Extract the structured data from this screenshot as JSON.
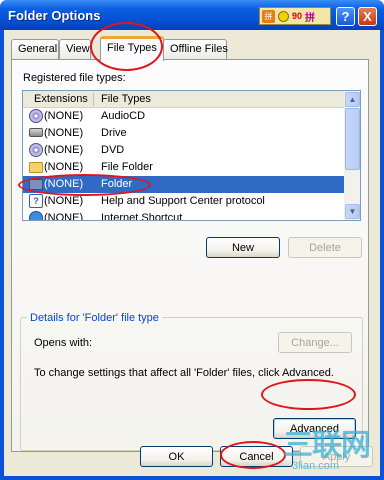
{
  "window": {
    "title": "Folder Options"
  },
  "ime_bar": {
    "logo": "拼",
    "mode": "90",
    "han": "拼"
  },
  "titlebar_buttons": {
    "help": "?",
    "close": "X"
  },
  "tabs": [
    {
      "label": "General"
    },
    {
      "label": "View"
    },
    {
      "label": "File Types",
      "active": true
    },
    {
      "label": "Offline Files"
    }
  ],
  "registered_label": "Registered file types:",
  "list": {
    "columns": [
      "Extensions",
      "File Types"
    ],
    "rows": [
      {
        "ext": "(NONE)",
        "type": "AudioCD",
        "icon": "cd-icon"
      },
      {
        "ext": "(NONE)",
        "type": "Drive",
        "icon": "drive-icon"
      },
      {
        "ext": "(NONE)",
        "type": "DVD",
        "icon": "cd-icon"
      },
      {
        "ext": "(NONE)",
        "type": "File Folder",
        "icon": "folder-icon"
      },
      {
        "ext": "(NONE)",
        "type": "Folder",
        "icon": "folder-icon",
        "selected": true
      },
      {
        "ext": "(NONE)",
        "type": "Help and Support Center protocol",
        "icon": "help-icon"
      },
      {
        "ext": "(NONE)",
        "type": "Internet Shortcut",
        "icon": "web-icon"
      }
    ]
  },
  "buttons": {
    "new": "New",
    "delete": "Delete",
    "change": "Change...",
    "advanced": "Advanced",
    "ok": "OK",
    "cancel": "Cancel",
    "apply": "Apply"
  },
  "details": {
    "title": "Details for 'Folder' file type",
    "opens_with": "Opens with:",
    "info": "To change settings that affect all 'Folder' files, click Advanced."
  },
  "watermark": {
    "big": "三联网",
    "small": "3lian.com"
  },
  "colors": {
    "selection": "#316ac5",
    "titlebar": "#0450d2",
    "annotation": "#e0141b",
    "group_title": "#0046d5"
  }
}
